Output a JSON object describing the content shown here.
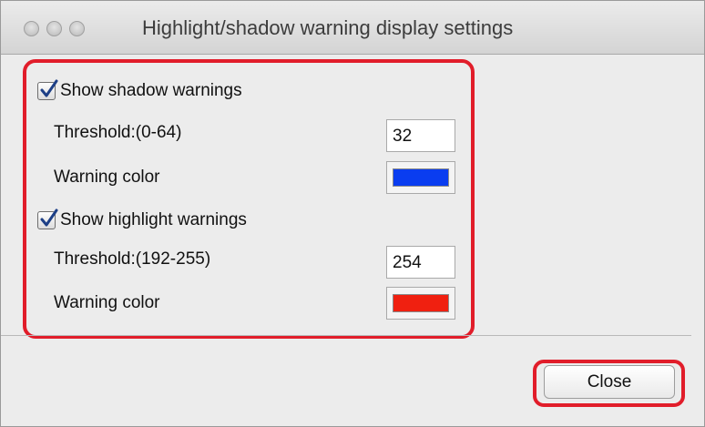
{
  "window": {
    "title": "Highlight/shadow warning display settings"
  },
  "shadow": {
    "checkbox_label": "Show shadow warnings",
    "checked": true,
    "threshold_label": "Threshold:(0-64)",
    "threshold_value": "32",
    "color_label": "Warning color",
    "color": "#0a3df0"
  },
  "highlight": {
    "checkbox_label": "Show highlight warnings",
    "checked": true,
    "threshold_label": "Threshold:(192-255)",
    "threshold_value": "254",
    "color_label": "Warning color",
    "color": "#f02010"
  },
  "buttons": {
    "close_label": "Close"
  },
  "annotation_color": "#e11d2a"
}
